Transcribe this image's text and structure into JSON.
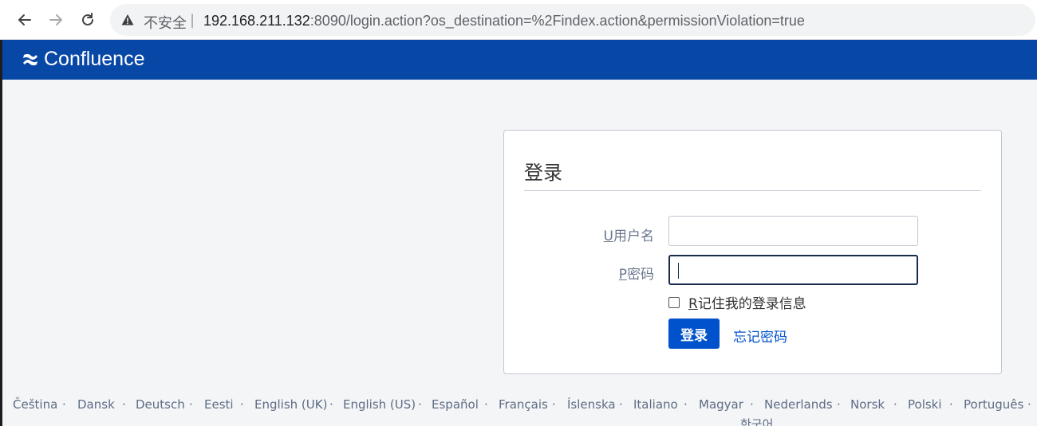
{
  "browser": {
    "insecure_label": "不安全",
    "url_host": "192.168.211.132",
    "url_rest": ":8090/login.action?os_destination=%2Findex.action&permissionViolation=true"
  },
  "app": {
    "name": "Confluence",
    "header_color": "#0747a6"
  },
  "login": {
    "title": "登录",
    "username_accesskey": "U",
    "username_label": "用户名",
    "username_value": "",
    "password_accesskey": "P",
    "password_label": "密码",
    "password_value": "",
    "remember_accesskey": "R",
    "remember_label": "记住我的登录信息",
    "remember_checked": false,
    "submit_label": "登录",
    "forgot_label": "忘记密码",
    "accent_color": "#0052cc"
  },
  "languages": [
    "Čeština",
    "Dansk",
    "Deutsch",
    "Eesti",
    "English (UK)",
    "English (US)",
    "Español",
    "Français",
    "Íslenska",
    "Italiano",
    "Magyar",
    "Nederlands",
    "Norsk",
    "Polski",
    "Português",
    "한국어"
  ]
}
